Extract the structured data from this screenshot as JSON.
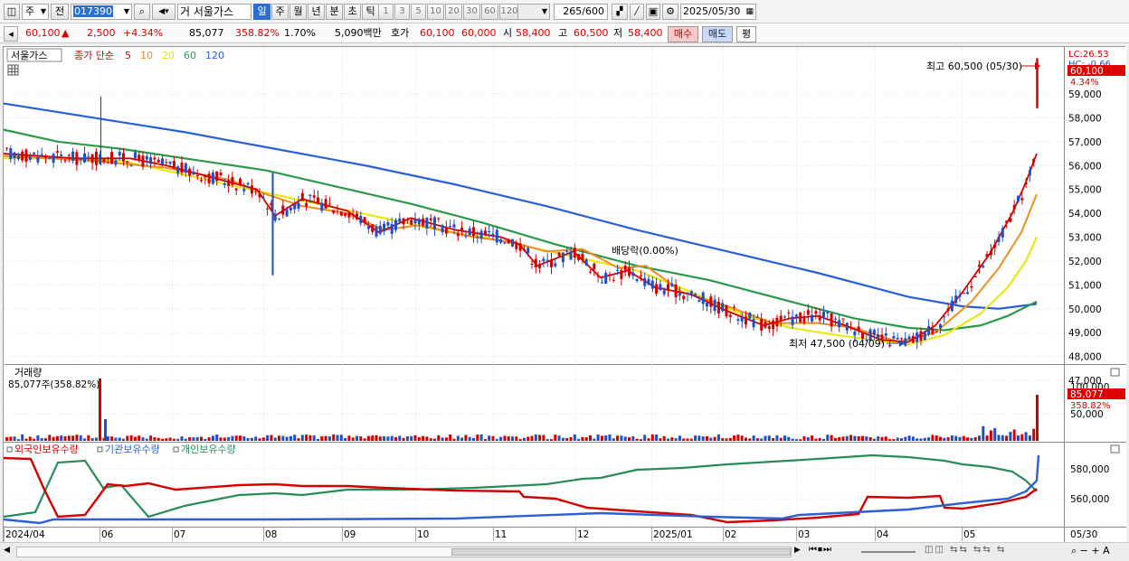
{
  "toolbar": {
    "market": "주",
    "market_mode": "전",
    "code": "017390",
    "stock_name": "서울가스",
    "name_prefix": "거",
    "periods": [
      "일",
      "주",
      "월",
      "년",
      "분",
      "초",
      "틱"
    ],
    "active_period": "일",
    "ticks": [
      "1",
      "3",
      "5",
      "10",
      "20",
      "30",
      "60",
      "120"
    ],
    "count": "265",
    "count_total": "/600",
    "date": "2025/05/30"
  },
  "quote": {
    "price": "60,100",
    "arrow": "▲",
    "change": "2,500",
    "change_pct": "+4.34%",
    "volume": "85,077",
    "volume_ratio": "358.82%",
    "turnover": "1.70%",
    "amount": "5,090백만",
    "bid_label": "호가",
    "bid": "60,100",
    "ask": "60,000",
    "open_label": "시",
    "open": "58,400",
    "high_label": "고",
    "high": "60,500",
    "low_label": "저",
    "low": "58,400",
    "buy_label": "매수",
    "sell_label": "매도",
    "eval_label": "평"
  },
  "legend": {
    "name": "서울가스",
    "ma_title": "종가 단순",
    "ma": [
      {
        "period": "5",
        "color": "#d40000"
      },
      {
        "period": "10",
        "color": "#f08c1e"
      },
      {
        "period": "20",
        "color": "#e8e800"
      },
      {
        "period": "60",
        "color": "#2a9a4a"
      },
      {
        "period": "120",
        "color": "#2b5fd6"
      }
    ]
  },
  "price_pane": {
    "y_ticks": [
      "59,000",
      "58,000",
      "57,000",
      "56,000",
      "55,000",
      "54,000",
      "53,000",
      "52,000",
      "51,000",
      "50,000",
      "49,000",
      "48,000",
      "47,000"
    ],
    "lc_label": "LC:26.53",
    "hc_label": "HC: -0.66",
    "cur_price": "60,100",
    "cur_pct": "4.34%",
    "high_note": "최고 60,500 (05/30)",
    "low_note": "최저 47,500 (04/09)",
    "div_note": "배당락(0.00%)"
  },
  "volume_pane": {
    "title": "거래량",
    "subtitle": "85,077주(358.82%)",
    "y_ticks": [
      "100,000",
      "50,000"
    ],
    "cur_value": "85,077",
    "cur_pct": "358.82%"
  },
  "holding_pane": {
    "titles": [
      "외국인보유수량",
      "기관보유수량",
      "개인보유수량"
    ],
    "colors": {
      "foreign": "#d40000",
      "inst": "#2b5fd6",
      "retail": "#2a8a5a"
    },
    "y_ticks": [
      "580,000",
      "560,000"
    ]
  },
  "x_axis": {
    "labels": [
      "2024/04",
      "06",
      "07",
      "08",
      "09",
      "10",
      "11",
      "12",
      "2025/01",
      "02",
      "03",
      "04",
      "05"
    ],
    "last": "05/30"
  },
  "colors": {
    "up": "#d40000",
    "down": "#1e4fc8",
    "accent": "#2d6fcf"
  }
}
